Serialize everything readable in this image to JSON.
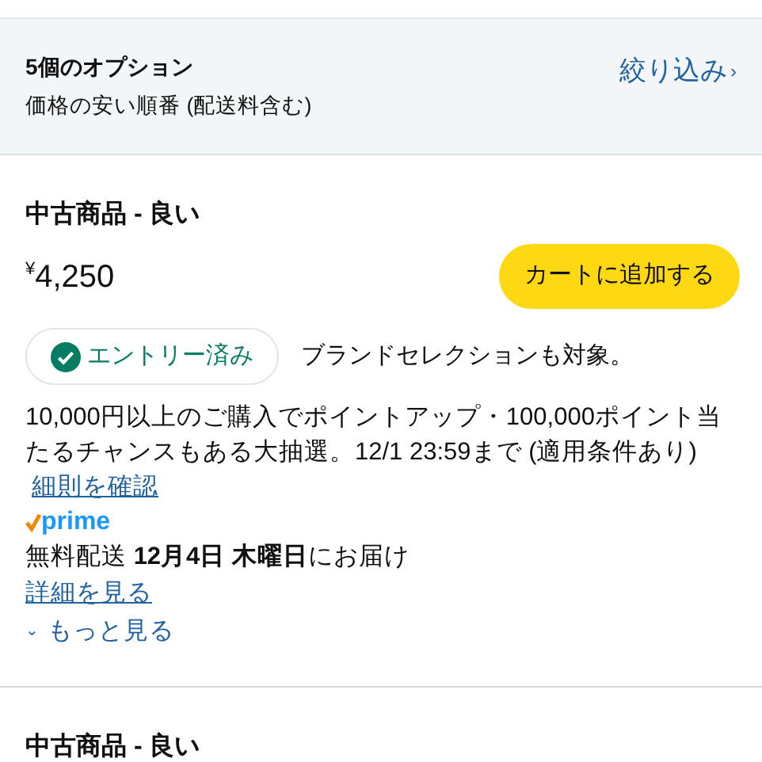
{
  "header": {
    "title": "5個のオプション",
    "subtitle": "価格の安い順番 (配送料含む)",
    "filter_link": "絞り込み",
    "filter_chevron": "›"
  },
  "offers": [
    {
      "condition": "中古商品 - 良い",
      "currency": "¥",
      "price": "4,250",
      "cart_button": "カートに追加する",
      "entry_badge": "エントリー済み",
      "brand_note": "ブランドセレクションも対象。",
      "promo": "10,000円以上のご購入でポイントアップ・100,000ポイント当たるチャンスもある大抽選。12/1 23:59まで (適用条件あり)",
      "promo_link": "細則を確認",
      "prime": "prime",
      "shipping": "無料配送 **12月4日 木曜日**にお届け",
      "details_link": "詳細を見る",
      "more_link": "もっと見る",
      "more_chevron": "⌄"
    },
    {
      "condition": "中古商品 - 良い"
    }
  ]
}
